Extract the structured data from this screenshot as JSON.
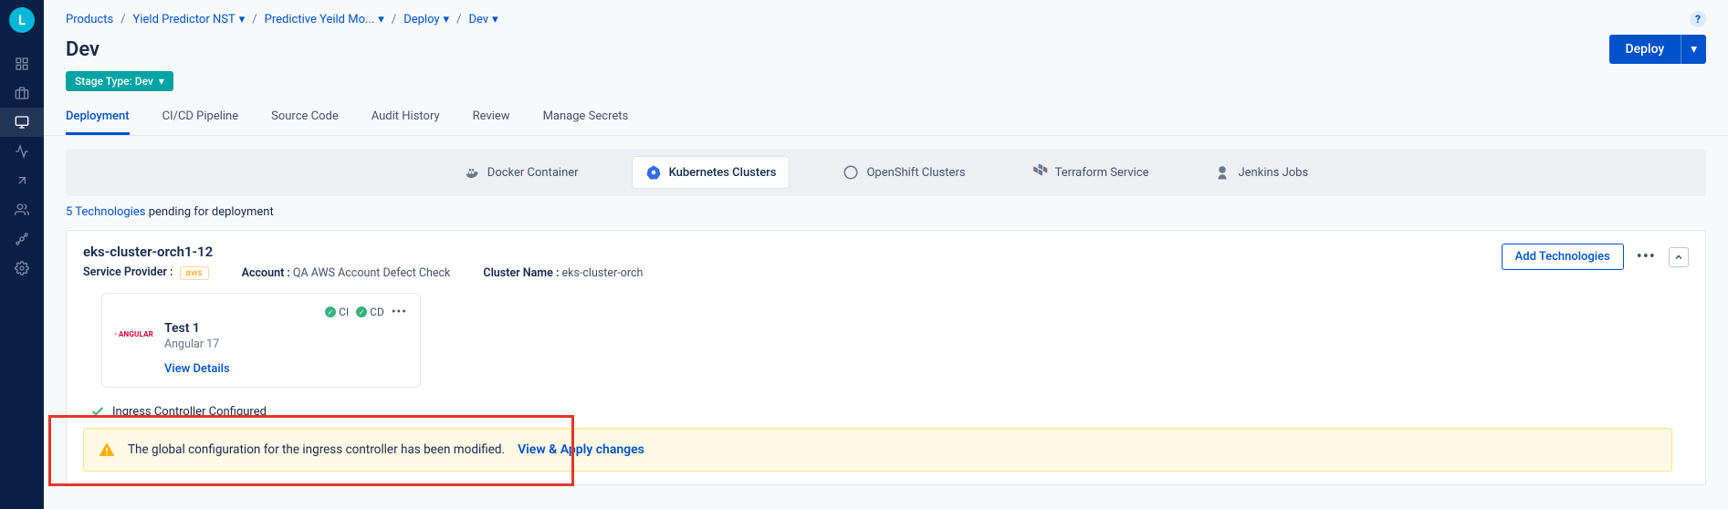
{
  "breadcrumbs": {
    "items": [
      "Products",
      "Yield Predictor NST",
      "Predictive Yeild Mo...",
      "Deploy",
      "Dev"
    ]
  },
  "page": {
    "title": "Dev",
    "stage_badge": "Stage Type: Dev",
    "deploy_btn": "Deploy"
  },
  "tabs": {
    "items": [
      "Deployment",
      "CI/CD Pipeline",
      "Source Code",
      "Audit History",
      "Review",
      "Manage Secrets"
    ]
  },
  "tech_tabs": {
    "items": [
      "Docker Container",
      "Kubernetes Clusters",
      "OpenShift Clusters",
      "Terraform Service",
      "Jenkins Jobs"
    ]
  },
  "pending": {
    "count": "5 Technologies",
    "rest": " pending for deployment"
  },
  "cluster": {
    "name": "eks-cluster-orch1-12",
    "provider_label": "Service Provider :",
    "provider_value": "aws",
    "account_label": "Account :",
    "account_value": "QA AWS Account Defect Check",
    "clustername_label": "Cluster Name :",
    "clustername_value": "eks-cluster-orch",
    "add_tech": "Add Technologies"
  },
  "tech_card": {
    "ci": "CI",
    "cd": "CD",
    "logo": "ANGULAR",
    "title": "Test 1",
    "subtitle": "Angular 17",
    "view": "View Details"
  },
  "ingress": {
    "configured": "Ingress Controller Configured"
  },
  "alert": {
    "text": "The global configuration for the ingress controller has been modified.",
    "link": "View & Apply changes"
  }
}
